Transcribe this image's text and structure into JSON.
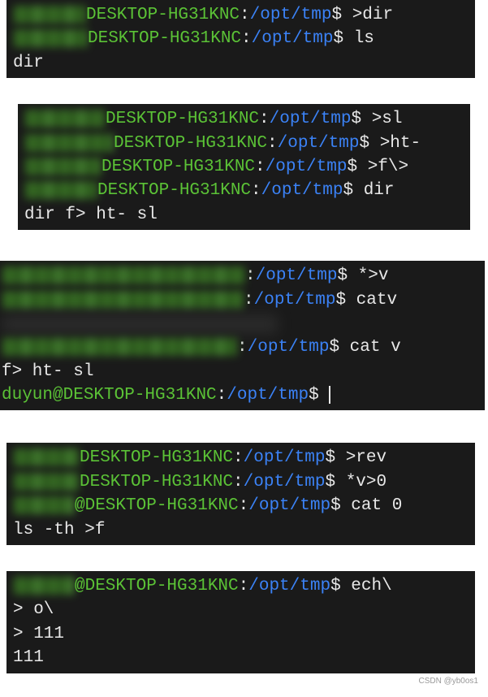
{
  "host": "DESKTOP-HG31KNC",
  "path": "/opt/tmp",
  "user_full": "duyun@DESKTOP-HG31KNC",
  "block1": {
    "l1_cmd": ">dir",
    "l2_cmd": "ls",
    "out": "dir"
  },
  "block2": {
    "l1_cmd": ">sl",
    "l2_cmd": ">ht-",
    "l3_cmd": ">f\\>",
    "l4_cmd": "dir",
    "out": "dir  f>  ht-  sl"
  },
  "block3": {
    "l1_cmd": "*>v",
    "l2_cmd": "catv",
    "l3_cmd": "cat v",
    "out": "f>  ht-  sl"
  },
  "block4": {
    "l1_cmd": ">rev",
    "l2_cmd": "*v>0",
    "l3_cmd": "cat 0",
    "out": "ls  -th  >f"
  },
  "block5": {
    "l1_cmd": "ech\\",
    "l2": "> o\\",
    "l3": ">  111",
    "out": "111"
  },
  "watermark": "CSDN @yb0os1"
}
